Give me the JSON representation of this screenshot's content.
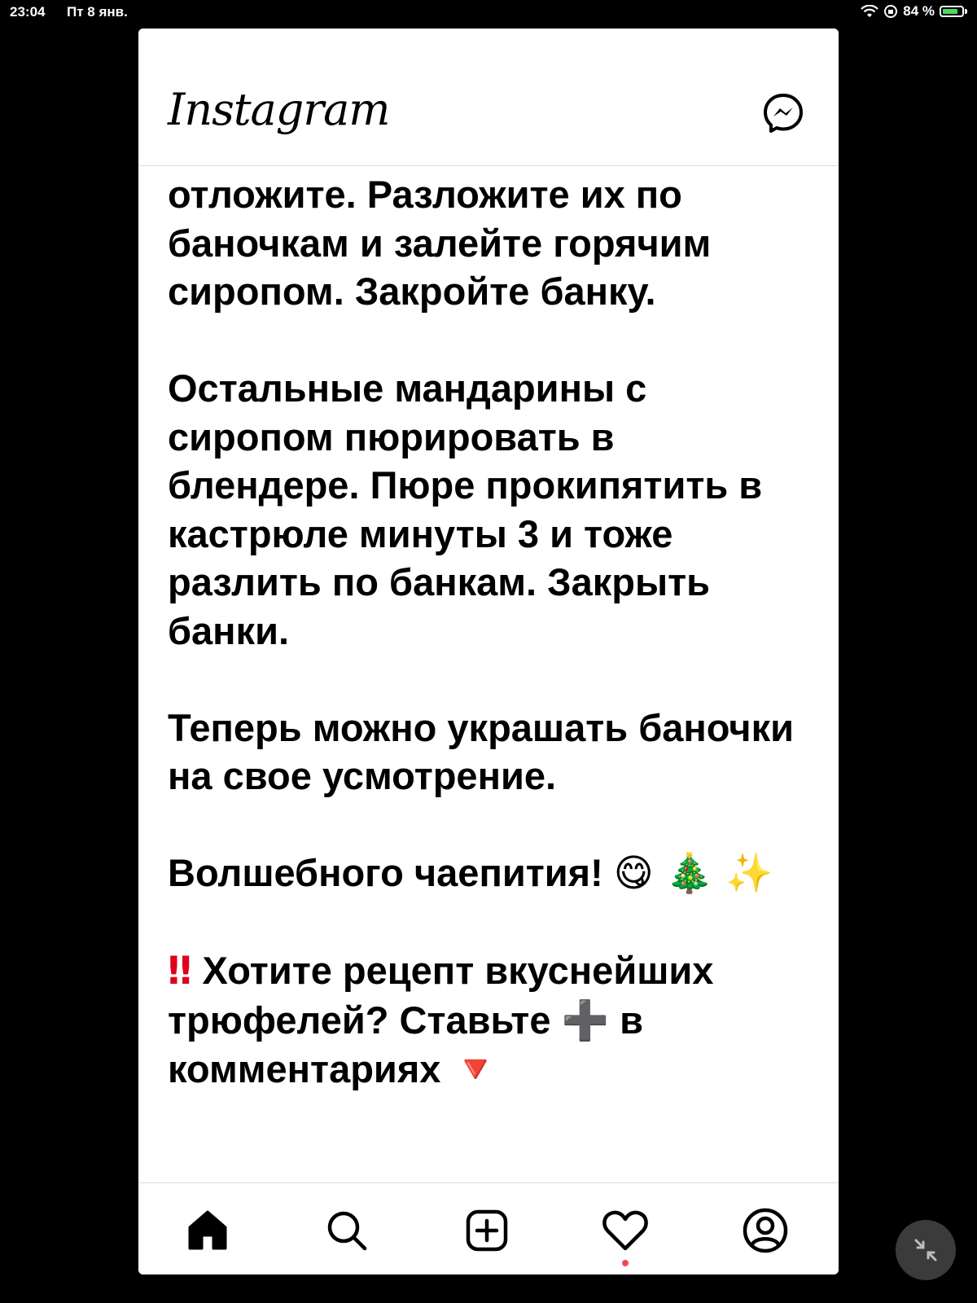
{
  "status_bar": {
    "time": "23:04",
    "date": "Пт 8 янв.",
    "battery_percent": "84 %",
    "battery_level": 0.84
  },
  "header": {
    "logo": "Instagram",
    "messenger_icon": "messenger-icon"
  },
  "post": {
    "paragraphs": [
      "отложите. Разложите их по баночкам и залейте горячим сиропом. Закройте банку.",
      "Остальные мандарины с сиропом пюрировать в блендере. Пюре прокипятить в кастрюле минуты 3 и тоже разлить по банкам. Закрыть банки.",
      "Теперь можно украшать баночки на свое усмотрение."
    ],
    "wish_text": "Волшебного чаепития!",
    "wish_emojis": "😋 🎄 ✨",
    "cta_mark": "‼",
    "cta_text_1": "Хотите рецепт вкуснейших трюфелей? Ставьте",
    "cta_plus": "➕",
    "cta_text_2": "в комментариях",
    "cta_arrow": "🔻"
  },
  "tab_bar": {
    "items": [
      "home-icon",
      "search-icon",
      "new-post-icon",
      "activity-icon",
      "profile-icon"
    ]
  },
  "colors": {
    "accent_red": "#ed4956",
    "text": "#000000",
    "background": "#ffffff"
  }
}
